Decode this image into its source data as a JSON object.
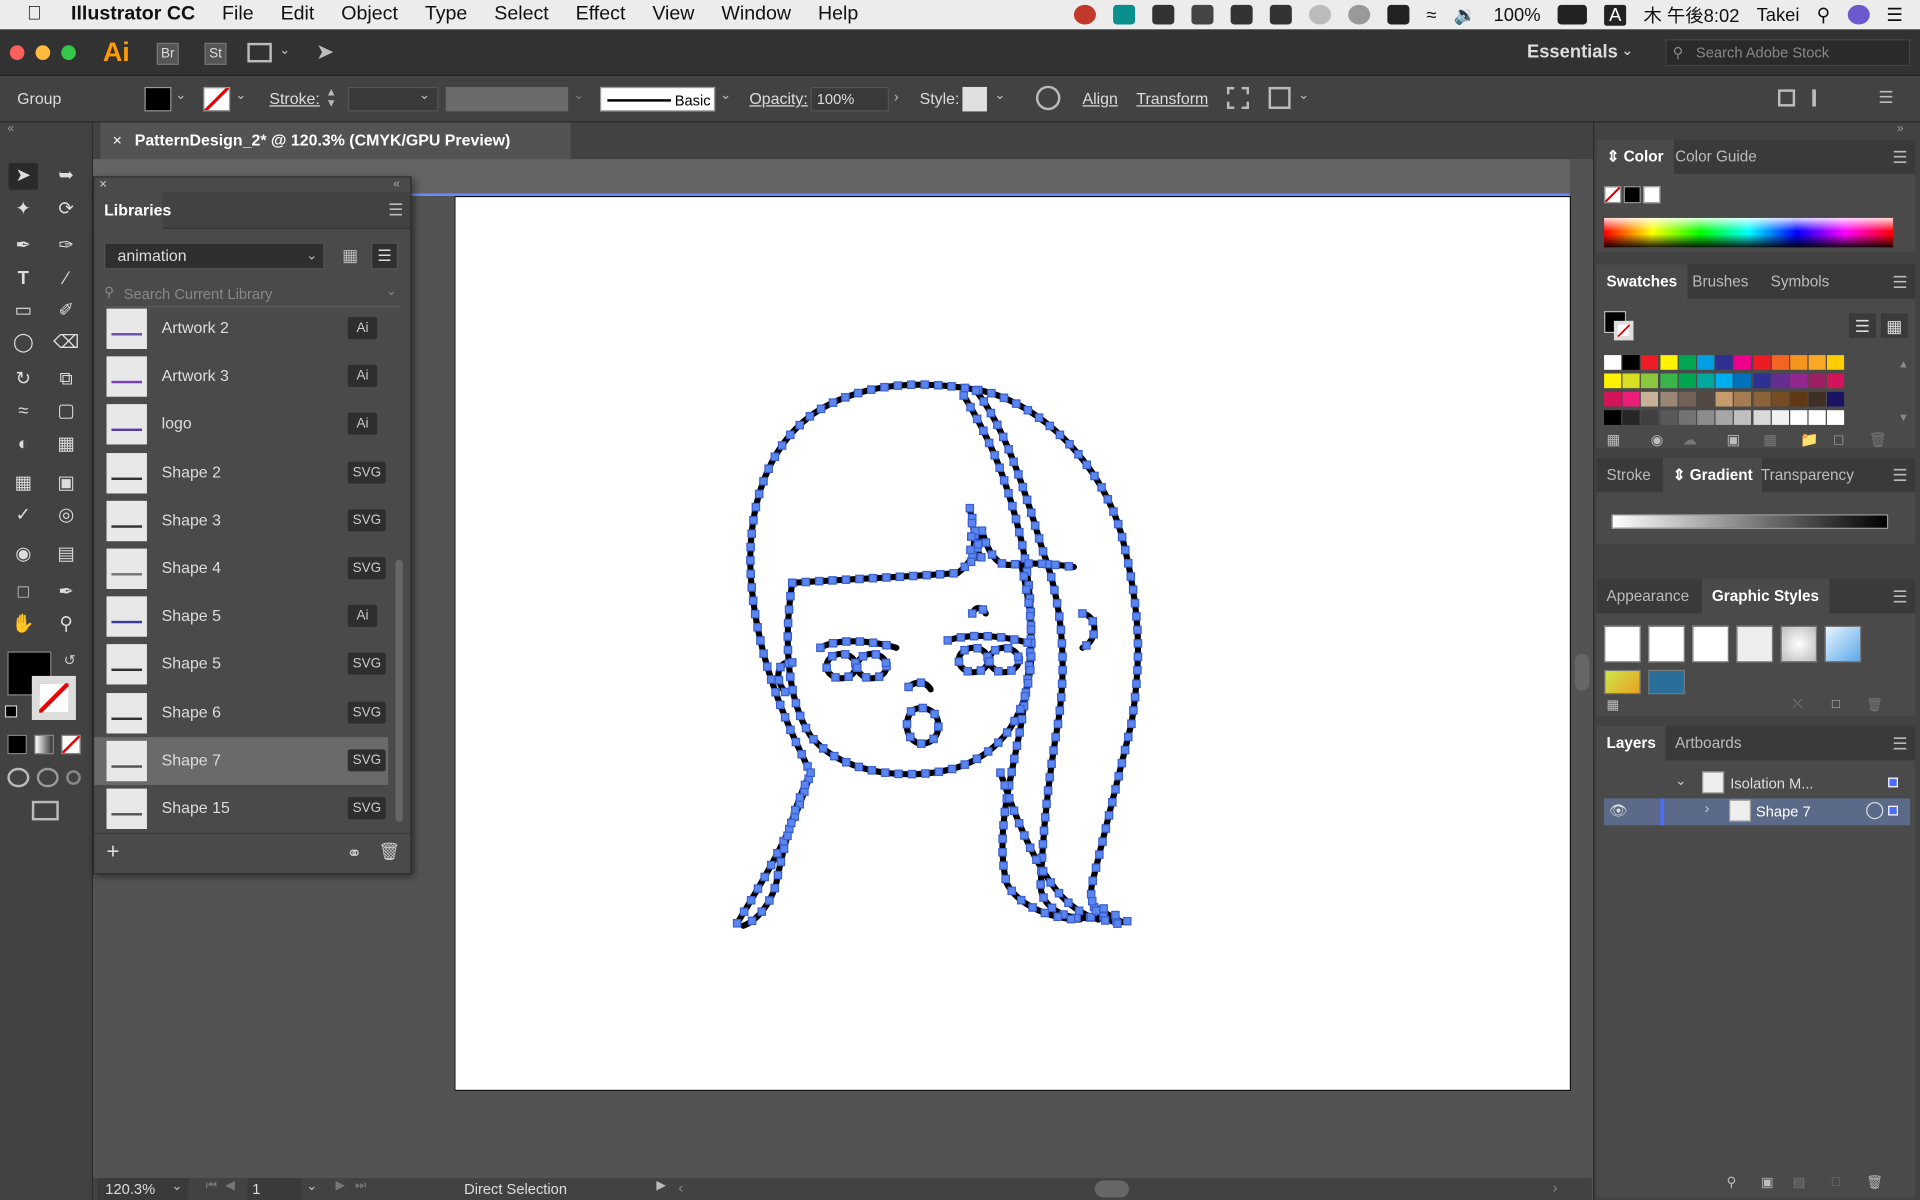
{
  "menubar": {
    "app_name": "Illustrator CC",
    "items": [
      "File",
      "Edit",
      "Object",
      "Type",
      "Select",
      "Effect",
      "View",
      "Window",
      "Help"
    ],
    "battery": "100%",
    "input_indicator": "A",
    "clock": "木 午後8:02",
    "user": "Takei"
  },
  "appbar": {
    "logo": "Ai",
    "bridge": "Br",
    "stock_app": "St",
    "workspace": "Essentials",
    "stock_placeholder": "Search Adobe Stock"
  },
  "control_bar": {
    "selection_type": "Group",
    "stroke_label": "Stroke:",
    "brush_label": "Basic",
    "opacity_label": "Opacity:",
    "opacity_value": "100%",
    "style_label": "Style:",
    "align_label": "Align",
    "transform_label": "Transform"
  },
  "document": {
    "tab_title": "PatternDesign_2* @ 120.3% (CMYK/GPU Preview)",
    "zoom": "120.3%",
    "artboard_number": "1",
    "status_tool": "Direct Selection"
  },
  "libraries": {
    "title": "Libraries",
    "selected_library": "animation",
    "search_placeholder": "Search Current Library",
    "items": [
      {
        "label": "Artwork 2",
        "type": "Ai"
      },
      {
        "label": "Artwork 3",
        "type": "Ai"
      },
      {
        "label": "logo",
        "type": "Ai"
      },
      {
        "label": "Shape 2",
        "type": "SVG"
      },
      {
        "label": "Shape 3",
        "type": "SVG"
      },
      {
        "label": "Shape 4",
        "type": "SVG"
      },
      {
        "label": "Shape 5",
        "type": "Ai"
      },
      {
        "label": "Shape 5",
        "type": "SVG"
      },
      {
        "label": "Shape 6",
        "type": "SVG"
      },
      {
        "label": "Shape 7",
        "type": "SVG"
      },
      {
        "label": "Shape 15",
        "type": "SVG"
      }
    ],
    "selected_index": 9
  },
  "right_panels": {
    "color_tabs": [
      "Color",
      "Color Guide"
    ],
    "swatch_tabs": [
      "Swatches",
      "Brushes",
      "Symbols"
    ],
    "stroke_tabs": [
      "Stroke",
      "Gradient",
      "Transparency"
    ],
    "appearance_tabs": [
      "Appearance",
      "Graphic Styles"
    ],
    "layer_tabs": [
      "Layers",
      "Artboards"
    ],
    "layers": [
      {
        "label": "Isolation M..."
      },
      {
        "label": "Shape 7"
      }
    ]
  },
  "swatch_colors": [
    [
      "#ffffff",
      "#000000",
      "#ee1c25",
      "#fff200",
      "#00a651",
      "#009fe3",
      "#2e3192",
      "#ec008c",
      "#ed1c24",
      "#f26522",
      "#f7941d",
      "#f9a825",
      "#ffcc00"
    ],
    [
      "#fff200",
      "#d7df23",
      "#8dc63f",
      "#39b54a",
      "#00a651",
      "#00a99d",
      "#00aeef",
      "#0072bc",
      "#2e3192",
      "#662d91",
      "#92278f",
      "#9e1f63",
      "#d4145a"
    ],
    [
      "#d4145a",
      "#ed1e79",
      "#c7b299",
      "#998675",
      "#736357",
      "#534741",
      "#c69c6d",
      "#a67c52",
      "#8c6239",
      "#754c24",
      "#603813",
      "#3f2f25",
      "#1b1464"
    ],
    [
      "#000000",
      "#262626",
      "#404040",
      "#595959",
      "#737373",
      "#8c8c8c",
      "#a6a6a6",
      "#bfbfbf",
      "#d9d9d9",
      "#f2f2f2",
      "#ffffff",
      "#ffffff",
      "#ffffff"
    ]
  ]
}
